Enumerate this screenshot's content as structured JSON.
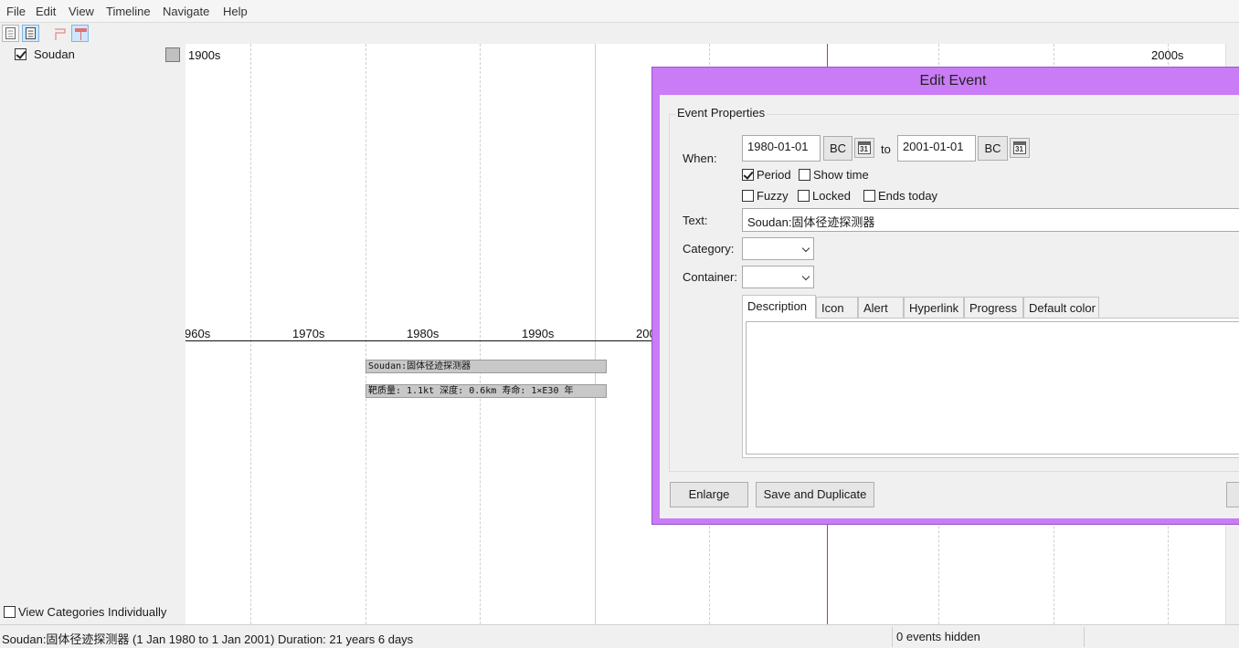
{
  "menu": [
    "File",
    "Edit",
    "View",
    "Timeline",
    "Navigate",
    "Help"
  ],
  "sidebar": {
    "categories": [
      {
        "label": "Soudan",
        "checked": true,
        "color": "#c0c0c0"
      }
    ],
    "view_individually_label": "View Categories Individually",
    "view_individually_checked": false
  },
  "timeline": {
    "major_labels": {
      "left": "1900s",
      "right": "2000s"
    },
    "minor_labels": [
      "960s",
      "1970s",
      "1980s",
      "1990s",
      "200"
    ],
    "events": [
      {
        "text": "Soudan:固体径迹探测器"
      },
      {
        "text": "靶质量: 1.1kt 深度: 0.6km 寿命: 1×E30 年"
      }
    ]
  },
  "dialog": {
    "title": "Edit Event",
    "group_title": "Event Properties",
    "when_label": "When:",
    "start_date": "1980-01-01",
    "start_era": "BC",
    "to_label": "to",
    "end_date": "2001-01-01",
    "end_era": "BC",
    "calendar_glyph": "31",
    "options": {
      "period": {
        "label": "Period",
        "checked": true
      },
      "show_time": {
        "label": "Show time",
        "checked": false
      },
      "fuzzy": {
        "label": "Fuzzy",
        "checked": false
      },
      "locked": {
        "label": "Locked",
        "checked": false
      },
      "ends_today": {
        "label": "Ends today",
        "checked": false
      }
    },
    "text_label": "Text:",
    "text_value": "Soudan:固体径迹探测器",
    "category_label": "Category:",
    "container_label": "Container:",
    "tabs": [
      "Description",
      "Icon",
      "Alert",
      "Hyperlink",
      "Progress",
      "Default color"
    ],
    "selected_tab": "Description",
    "buttons": {
      "enlarge": "Enlarge",
      "save_duplicate": "Save and Duplicate"
    }
  },
  "status": {
    "event_summary": "Soudan:固体径迹探测器 (1 Jan 1980 to 1 Jan 2001)  Duration: 21 years 6 days",
    "hidden": "0 events hidden"
  },
  "colors": {
    "dialog_frame": "#c97cf5",
    "now_line": "#c23b3b",
    "event_bar": "#c8c8c8"
  }
}
